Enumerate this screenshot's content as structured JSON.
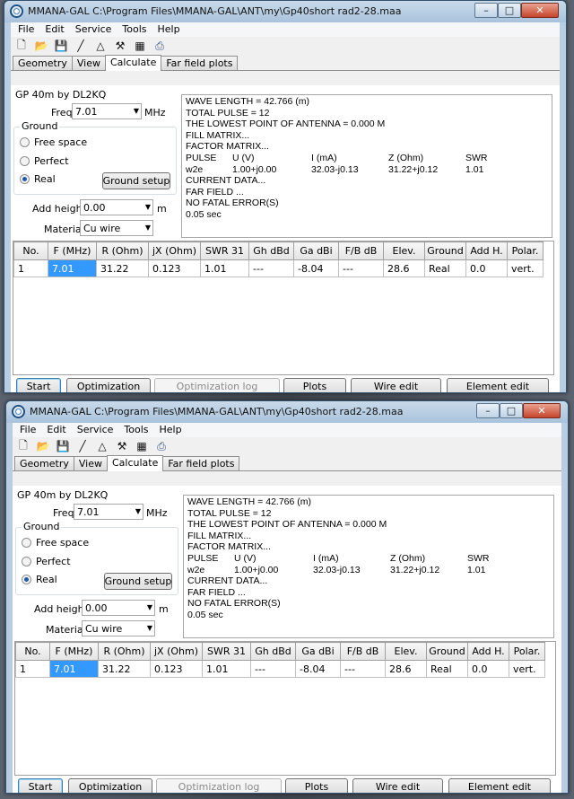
{
  "titlebar": {
    "title": "MMANA-GAL C:\\Program Files\\MMANA-GAL\\ANT\\my\\Gp40short rad2-28.maa",
    "min": "–",
    "max": "□",
    "close": "✕"
  },
  "menu": [
    "File",
    "Edit",
    "Service",
    "Tools",
    "Help"
  ],
  "toolbar_icons": [
    "new-icon",
    "open-icon",
    "save-icon",
    "line-icon",
    "triangle-icon",
    "tools-icon",
    "calculator-icon",
    "print-icon"
  ],
  "tabs": [
    {
      "label": "Geometry",
      "active": false
    },
    {
      "label": "View",
      "active": false
    },
    {
      "label": "Calculate",
      "active": true
    },
    {
      "label": "Far field plots",
      "active": false
    }
  ],
  "calc": {
    "project": "GP 40m by DL2KQ",
    "freq_label": "Freq",
    "freq_value": "7.01",
    "freq_unit": "MHz",
    "ground_label": "Ground",
    "ground_options": [
      "Free space",
      "Perfect",
      "Real"
    ],
    "ground_selected": "Real",
    "ground_setup": "Ground setup",
    "add_height_label": "Add height",
    "add_height_value": "0.00",
    "add_height_unit": "m",
    "material_label": "Material",
    "material_value": "Cu wire"
  },
  "log": {
    "lines": [
      "WAVE LENGTH = 42.766 (m)",
      "TOTAL PULSE = 12",
      "THE LOWEST POINT OF ANTENNA = 0.000 M",
      "FILL MATRIX...",
      "FACTOR MATRIX..."
    ],
    "table_header": [
      "PULSE",
      "U (V)",
      "I (mA)",
      "Z (Ohm)",
      "SWR"
    ],
    "table_row": [
      "w2e",
      "1.00+j0.00",
      "32.03-j0.13",
      "31.22+j0.12",
      "1.01"
    ],
    "tail": [
      "CURRENT DATA...",
      "FAR FIELD ...",
      "NO FATAL ERROR(S)",
      "0.05 sec"
    ]
  },
  "grid": {
    "columns": [
      "No.",
      "F (MHz)",
      "R (Ohm)",
      "jX (Ohm)",
      "SWR 31",
      "Gh dBd",
      "Ga dBi",
      "F/B dB",
      "Elev.",
      "Ground",
      "Add H.",
      "Polar."
    ],
    "rows": [
      [
        "1",
        "7.01",
        "31.22",
        "0.123",
        "1.01",
        "---",
        "-8.04",
        "---",
        "28.6",
        "Real",
        "0.0",
        "vert."
      ]
    ]
  },
  "buttons": {
    "start": "Start",
    "optimization": "Optimization",
    "optimization_log": "Optimization log",
    "plots": "Plots",
    "wire_edit": "Wire edit",
    "element_edit": "Element edit"
  }
}
